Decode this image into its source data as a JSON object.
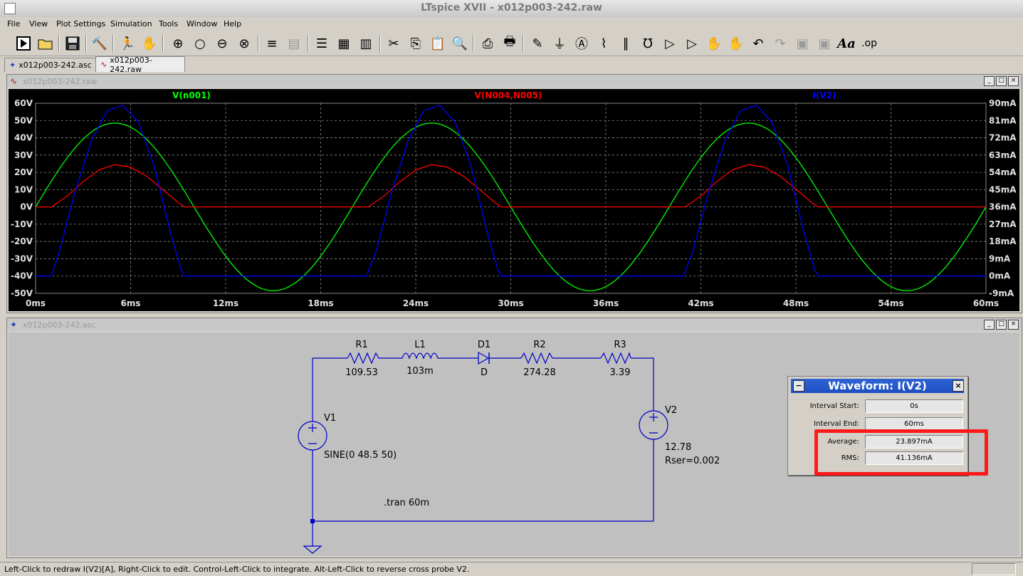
{
  "window": {
    "title": "LTspice XVII - x012p003-242.raw"
  },
  "menu": [
    "File",
    "View",
    "Plot Settings",
    "Simulation",
    "Tools",
    "Window",
    "Help"
  ],
  "tabs": [
    {
      "label": "x012p003-242.asc",
      "active": false
    },
    {
      "label": "x012p003-242.raw",
      "active": true
    }
  ],
  "plot_window": {
    "title": "x012p003-242.raw",
    "traces": [
      {
        "name": "V(n001)",
        "color": "#00ff00"
      },
      {
        "name": "V(N004,N005)",
        "color": "#ff0000"
      },
      {
        "name": "I(V2)",
        "color": "#0000ff"
      }
    ]
  },
  "chart_data": {
    "type": "line",
    "title": "",
    "xlabel": "",
    "x_ticks": [
      "0ms",
      "6ms",
      "12ms",
      "18ms",
      "24ms",
      "30ms",
      "36ms",
      "42ms",
      "48ms",
      "54ms",
      "60ms"
    ],
    "xlim_ms": [
      0,
      60
    ],
    "y_left_ticks": [
      "60V",
      "50V",
      "40V",
      "30V",
      "20V",
      "10V",
      "0V",
      "-10V",
      "-20V",
      "-30V",
      "-40V",
      "-50V"
    ],
    "ylim_left": [
      -50,
      60
    ],
    "y_right_ticks": [
      "90mA",
      "81mA",
      "72mA",
      "63mA",
      "54mA",
      "45mA",
      "36mA",
      "27mA",
      "18mA",
      "9mA",
      "0mA",
      "-9mA"
    ],
    "ylim_right_mA": [
      -9,
      90
    ],
    "grid": true,
    "series": [
      {
        "name": "V(n001)",
        "axis": "left",
        "color": "#00ff00",
        "x_ms": [
          0,
          2.5,
          5,
          7.5,
          10,
          12.5,
          15,
          17.5,
          20,
          22.5,
          25,
          27.5,
          30,
          32.5,
          35,
          37.5,
          40,
          42.5,
          45,
          47.5,
          50,
          52.5,
          55,
          57.5,
          60
        ],
        "y": [
          0,
          34.3,
          48.5,
          34.3,
          0,
          -34.3,
          -48.5,
          -34.3,
          0,
          34.3,
          48.5,
          34.3,
          0,
          -34.3,
          -48.5,
          -34.3,
          0,
          34.3,
          48.5,
          34.3,
          0,
          -34.3,
          -48.5,
          -34.3,
          0
        ]
      },
      {
        "name": "V(N004,N005)",
        "axis": "left",
        "color": "#ff0000",
        "x_ms": [
          0,
          1.0,
          2.0,
          3.0,
          4.0,
          5.0,
          6.0,
          7.0,
          8.0,
          9.0,
          9.4,
          21.0,
          22.0,
          23.0,
          24.0,
          25.0,
          26.0,
          27.0,
          28.0,
          29.0,
          29.4,
          41.0,
          42.0,
          43.0,
          44.0,
          45.0,
          46.0,
          47.0,
          48.0,
          49.0,
          49.4,
          60
        ],
        "y": [
          0,
          0,
          6.3,
          14.6,
          21.4,
          24.5,
          23.0,
          17.8,
          10.3,
          2.5,
          0,
          0,
          6.3,
          14.6,
          21.4,
          24.5,
          23.0,
          17.8,
          10.3,
          2.5,
          0,
          0,
          6.3,
          14.6,
          21.4,
          24.5,
          23.0,
          17.8,
          10.3,
          2.5,
          0,
          0
        ]
      },
      {
        "name": "I(V2)",
        "axis": "right",
        "color": "#0000ff",
        "x_ms": [
          0,
          1.0,
          1.5,
          2.5,
          3.5,
          4.5,
          5.5,
          6.5,
          7.5,
          8.5,
          9.2,
          9.4,
          20.9,
          21.5,
          22.5,
          23.5,
          24.5,
          25.5,
          26.5,
          27.5,
          28.5,
          29.2,
          29.4,
          40.9,
          41.5,
          42.5,
          43.5,
          44.5,
          45.5,
          46.5,
          47.5,
          48.5,
          49.2,
          49.4,
          60
        ],
        "y_mA": [
          0,
          0,
          13,
          44,
          70,
          86,
          89,
          80,
          57,
          23,
          3,
          0,
          0,
          13,
          44,
          70,
          86,
          89,
          80,
          57,
          23,
          3,
          0,
          0,
          13,
          44,
          70,
          86,
          89,
          80,
          57,
          23,
          3,
          0,
          0
        ]
      }
    ]
  },
  "schematic_window": {
    "title": "x012p003-242.asc",
    "components": [
      {
        "ref": "R1",
        "value": "109.53"
      },
      {
        "ref": "L1",
        "value": "103m"
      },
      {
        "ref": "D1",
        "value": "D"
      },
      {
        "ref": "R2",
        "value": "274.28"
      },
      {
        "ref": "R3",
        "value": "3.39"
      },
      {
        "ref": "V1",
        "value": "SINE(0 48.5 50)"
      },
      {
        "ref": "V2",
        "value": "12.78",
        "extra": "Rser=0.002"
      }
    ],
    "directive": ".tran 60m"
  },
  "waveform_dialog": {
    "title": "Waveform: I(V2)",
    "interval_start_label": "Interval Start:",
    "interval_start": "0s",
    "interval_end_label": "Interval End:",
    "interval_end": "60ms",
    "average_label": "Average:",
    "average": "23.897mA",
    "rms_label": "RMS:",
    "rms": "41.136mA"
  },
  "status_bar": {
    "text": "Left-Click to redraw I(V2)[A],  Right-Click to edit. Control-Left-Click to integrate. Alt-Left-Click to reverse cross probe V2."
  }
}
